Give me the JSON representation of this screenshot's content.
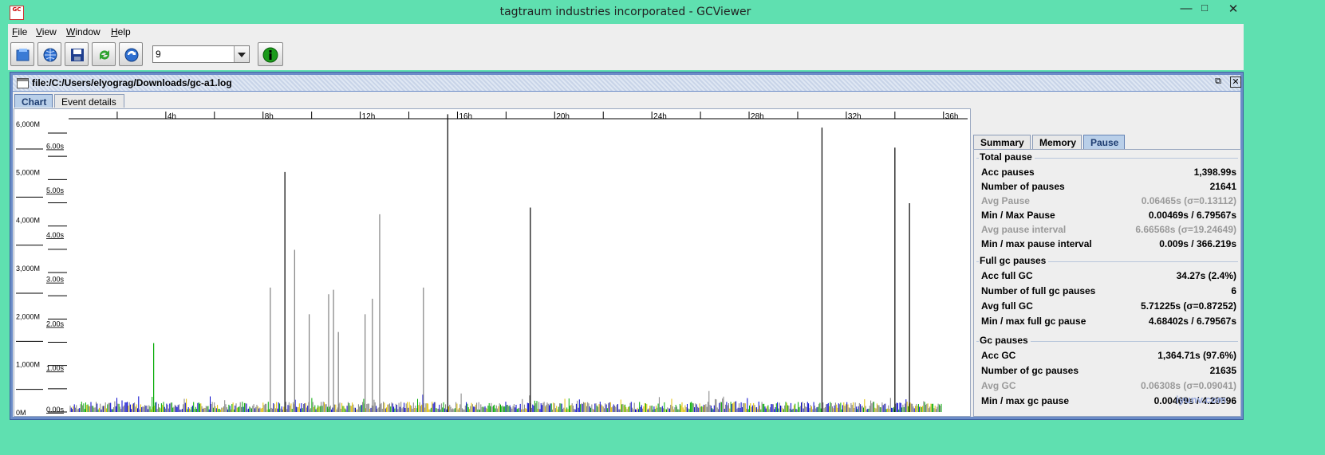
{
  "window": {
    "title": "tagtraum industries incorporated - GCViewer",
    "app_icon_text": "GC",
    "app_icon_subtext": "VIEWER",
    "controls": {
      "minimize": "—",
      "maximize": "□",
      "close": "✕"
    }
  },
  "menu": [
    {
      "label": "File",
      "mnemonic": "F",
      "rest": "ile"
    },
    {
      "label": "View",
      "mnemonic": "V",
      "rest": "iew"
    },
    {
      "label": "Window",
      "mnemonic": "W",
      "rest": "indow"
    },
    {
      "label": "Help",
      "mnemonic": "H",
      "rest": "elp"
    }
  ],
  "toolbar": {
    "buttons": [
      "open-file-icon",
      "open-url-icon",
      "save-icon",
      "refresh-icon",
      "watch-icon"
    ],
    "zoom_value": "9",
    "info_button": "info-icon"
  },
  "document": {
    "title": "file:/C:/Users/elyograg/Downloads/gc-a1.log",
    "tabs": [
      "Chart",
      "Event details"
    ],
    "active_tab": "Chart"
  },
  "chart_data": {
    "type": "bar",
    "x_ticks": [
      "4h",
      "8h",
      "12h",
      "16h",
      "20h",
      "24h",
      "28h",
      "32h",
      "36h"
    ],
    "x_range_hours": [
      0,
      36.5
    ],
    "memory_axis": [
      "6,000M",
      "5,000M",
      "4,000M",
      "3,000M",
      "2,000M",
      "1,000M",
      "0M"
    ],
    "pause_axis": [
      "6.00s",
      "5.00s",
      "4.00s",
      "3.00s",
      "2.00s",
      "1.00s",
      "0.00s"
    ],
    "pause_ylim": [
      0,
      6.6
    ],
    "series_colors": {
      "full_gc": "#000000",
      "gc": "#808080",
      "young": "#00aa00",
      "initial_mark": "#0000cc",
      "remark": "#e0c000"
    },
    "tall_pauses": [
      {
        "hour": 3.5,
        "seconds": 1.55,
        "kind": "young"
      },
      {
        "hour": 8.3,
        "seconds": 2.8,
        "kind": "gc"
      },
      {
        "hour": 8.9,
        "seconds": 5.4,
        "kind": "full_gc"
      },
      {
        "hour": 9.3,
        "seconds": 3.65,
        "kind": "gc"
      },
      {
        "hour": 9.9,
        "seconds": 2.2,
        "kind": "gc"
      },
      {
        "hour": 10.7,
        "seconds": 2.65,
        "kind": "gc"
      },
      {
        "hour": 10.9,
        "seconds": 2.75,
        "kind": "gc"
      },
      {
        "hour": 11.1,
        "seconds": 1.8,
        "kind": "gc"
      },
      {
        "hour": 12.2,
        "seconds": 2.2,
        "kind": "gc"
      },
      {
        "hour": 12.5,
        "seconds": 2.55,
        "kind": "gc"
      },
      {
        "hour": 12.8,
        "seconds": 4.45,
        "kind": "gc"
      },
      {
        "hour": 14.6,
        "seconds": 2.8,
        "kind": "gc"
      },
      {
        "hour": 15.6,
        "seconds": 6.7,
        "kind": "full_gc"
      },
      {
        "hour": 19.0,
        "seconds": 4.6,
        "kind": "full_gc"
      },
      {
        "hour": 31.0,
        "seconds": 6.4,
        "kind": "full_gc"
      },
      {
        "hour": 34.0,
        "seconds": 5.95,
        "kind": "full_gc"
      },
      {
        "hour": 34.6,
        "seconds": 4.7,
        "kind": "full_gc"
      }
    ]
  },
  "stats": {
    "tabs": [
      "Summary",
      "Memory",
      "Pause"
    ],
    "active_tab": "Pause",
    "groups": [
      {
        "title": "Total pause",
        "rows": [
          {
            "label": "Acc pauses",
            "value": "1,398.99s",
            "dim": false
          },
          {
            "label": "Number of pauses",
            "value": "21641",
            "dim": false
          },
          {
            "label": "Avg Pause",
            "value": "0.06465s (σ=0.13112)",
            "dim": true
          },
          {
            "label": "Min / Max Pause",
            "value": "0.00469s / 6.79567s",
            "dim": false
          },
          {
            "label": "Avg pause interval",
            "value": "6.66568s (σ=19.24649)",
            "dim": true
          },
          {
            "label": "Min / max pause interval",
            "value": "0.009s / 366.219s",
            "dim": false
          }
        ]
      },
      {
        "title": "Full gc pauses",
        "rows": [
          {
            "label": "Acc full GC",
            "value": "34.27s (2.4%)",
            "dim": false
          },
          {
            "label": "Number of full gc pauses",
            "value": "6",
            "dim": false
          },
          {
            "label": "Avg full GC",
            "value": "5.71225s (σ=0.87252)",
            "dim": false
          },
          {
            "label": "Min / max full gc pause",
            "value": "4.68402s / 6.79567s",
            "dim": false
          }
        ]
      },
      {
        "title": "Gc pauses",
        "rows": [
          {
            "label": "Acc GC",
            "value": "1,364.71s (97.6%)",
            "dim": false
          },
          {
            "label": "Number of gc pauses",
            "value": "21635",
            "dim": false
          },
          {
            "label": "Avg GC",
            "value": "0.06308s (σ=0.09041)",
            "dim": true
          },
          {
            "label": "Min / max gc pause",
            "value": "0.00469s / 4.29596",
            "dim": false
          }
        ]
      }
    ]
  },
  "watermark": "iyunv.com"
}
